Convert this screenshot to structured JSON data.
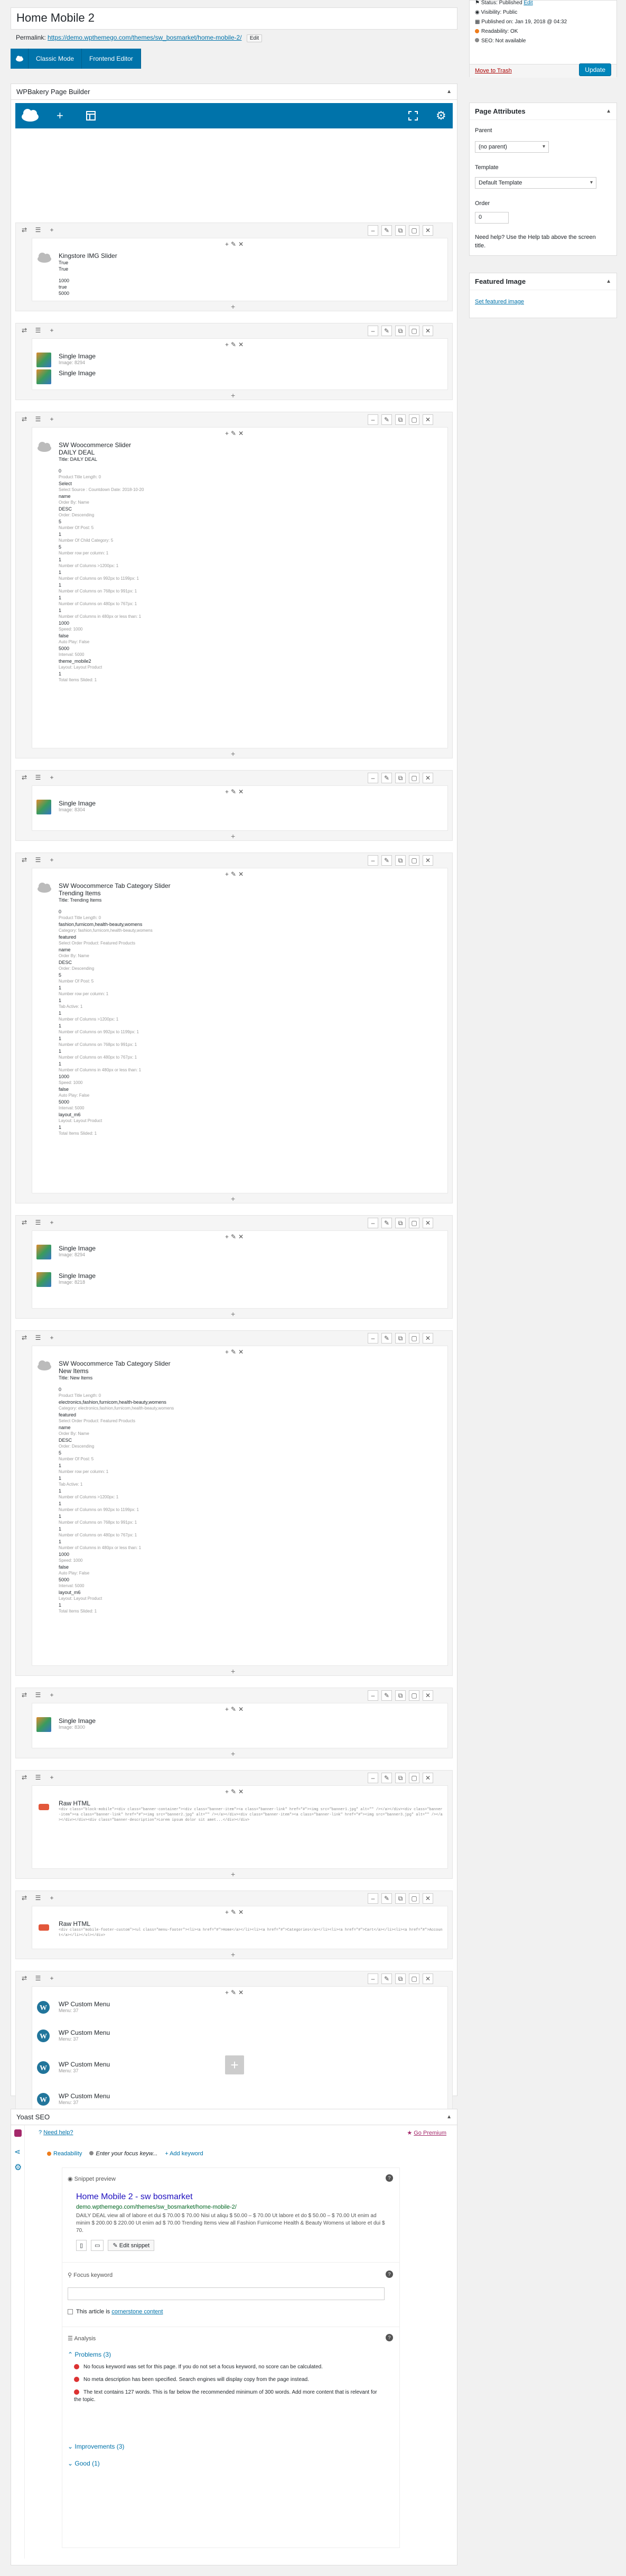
{
  "post": {
    "title": "Home Mobile 2",
    "permalink_label": "Permalink:",
    "permalink_url": "https://demo.wpthemego.com/themes/sw_bosmarket/home-mobile-2/",
    "permalink_edit": "Edit"
  },
  "modes": {
    "classic": "Classic Mode",
    "frontend": "Frontend Editor"
  },
  "builder": {
    "title": "WPBakery Page Builder"
  },
  "rows": [
    {
      "elements": [
        {
          "title": "Kingstore IMG Slider",
          "lines": [
            "True",
            "True",
            "",
            "1000",
            "true",
            "5000"
          ]
        }
      ]
    },
    {
      "elements": [
        {
          "title": "Single Image",
          "sub": "Image: 8294"
        },
        {
          "title": "Single Image",
          "sub": ""
        }
      ]
    },
    {
      "elements": [
        {
          "title": "SW Woocommerce Slider",
          "sub": "DAILY DEAL",
          "lines": [
            "Title: DAILY DEAL",
            "",
            "0",
            "Product Title Length: 0",
            "Select",
            "Select Source : Countdown Date: 2018-10-20",
            "name",
            "Order By: Name",
            "DESC",
            "Order: Descending",
            "5",
            "Number Of Post: 5",
            "1",
            "Number Of Child Category: 5",
            "5",
            "Number row per column: 1",
            "1",
            "Number of Columns >1200px: 1",
            "1",
            "Number of Columns on 992px to 1199px: 1",
            "1",
            "Number of Columns on 768px to 991px: 1",
            "1",
            "Number of Columns on 480px to 767px: 1",
            "1",
            "Number of Columns in 480px or less than: 1",
            "1000",
            "Speed: 1000",
            "false",
            "Auto Play: False",
            "5000",
            "Interval: 5000",
            "theme_mobile2",
            "Layout: Layout Product",
            "1",
            "Total Items Slided: 1"
          ]
        }
      ]
    },
    {
      "elements": [
        {
          "title": "Single Image",
          "sub": "Image: 8304"
        }
      ]
    },
    {
      "elements": [
        {
          "title": "SW Woocommerce Tab Category Slider",
          "sub": "Trending Items",
          "lines": [
            "Title: Trending Items",
            "",
            "0",
            "Product Title Length: 0",
            "fashion,furnicom,health-beauty,womens",
            "Category: fashion,furnicom,health-beauty,womens",
            "featured",
            "Select Order Product: Featured Products",
            "name",
            "Order By: Name",
            "DESC",
            "Order: Descending",
            "5",
            "Number Of Post: 5",
            "1",
            "Number row per column: 1",
            "1",
            "Tab Active: 1",
            "1",
            "Number of Columns >1200px: 1",
            "1",
            "Number of Columns on 992px to 1199px: 1",
            "1",
            "Number of Columns on 768px to 991px: 1",
            "1",
            "Number of Columns on 480px to 767px: 1",
            "1",
            "Number of Columns in 480px or less than: 1",
            "1000",
            "Speed: 1000",
            "false",
            "Auto Play: False",
            "5000",
            "Interval: 5000",
            "layout_m6",
            "Layout: Layout Product",
            "1",
            "Total Items Slided: 1"
          ]
        }
      ]
    },
    {
      "elements": [
        {
          "title": "Single Image",
          "sub": "Image: 8294"
        },
        {
          "title": "Single Image",
          "sub": "Image: 8218"
        }
      ]
    },
    {
      "elements": [
        {
          "title": "SW Woocommerce Tab Category Slider",
          "sub": "New Items",
          "lines": [
            "Title: New Items",
            "",
            "0",
            "Product Title Length: 0",
            "electronics,fashion,furnicom,health-beauty,womens",
            "Category: electronics,fashion,furnicom,health-beauty,womens",
            "featured",
            "Select Order Product: Featured Products",
            "name",
            "Order By: Name",
            "DESC",
            "Order: Descending",
            "5",
            "Number Of Post: 5",
            "1",
            "Number row per column: 1",
            "1",
            "Tab Active: 1",
            "1",
            "Number of Columns >1200px: 1",
            "1",
            "Number of Columns on 992px to 1199px: 1",
            "1",
            "Number of Columns on 768px to 991px: 1",
            "1",
            "Number of Columns on 480px to 767px: 1",
            "1",
            "Number of Columns in 480px or less than: 1",
            "1000",
            "Speed: 1000",
            "false",
            "Auto Play: False",
            "5000",
            "Interval: 5000",
            "layout_m6",
            "Layout: Layout Product",
            "1",
            "Total Items Slided: 1"
          ]
        }
      ]
    },
    {
      "elements": [
        {
          "title": "Single Image",
          "sub": "Image: 8300"
        }
      ]
    },
    {
      "elements": [
        {
          "title": "Raw HTML",
          "code": "<div class=\"block-mobile\"><div class=\"banner-container\"><div class=\"banner-item\"><a class=\"banner-link\" href=\"#\"><img src=\"banner1.jpg\" alt=\"\" /></a></div><div class=\"banner-item\"><a class=\"banner-link\" href=\"#\"><img src=\"banner2.jpg\" alt=\"\" /></a></div><div class=\"banner-item\"><a class=\"banner-link\" href=\"#\"><img src=\"banner3.jpg\" alt=\"\" /></a></div></div><div class=\"banner-description\">Lorem ipsum dolor sit amet...</div></div>"
        }
      ]
    },
    {
      "elements": [
        {
          "title": "Raw HTML",
          "code": "<div class=\"mobile-footer-custom\"><ul class=\"menu-footer\"><li><a href=\"#\">Home</a></li><li><a href=\"#\">Categories</a></li><li><a href=\"#\">Cart</a></li><li><a href=\"#\">Account</a></li></ul></div>"
        }
      ]
    },
    {
      "elements": [
        {
          "title": "WP Custom Menu",
          "sub": "Menu: 37"
        },
        {
          "title": "WP Custom Menu",
          "sub": "Menu: 37"
        },
        {
          "title": "WP Custom Menu",
          "sub": "Menu: 37"
        },
        {
          "title": "WP Custom Menu",
          "sub": "Menu: 37"
        }
      ]
    }
  ],
  "sidebar": {
    "publish": {
      "status_label": "Status: Published",
      "status_edit": "Edit",
      "visibility": "Visibility: Public",
      "published_on": "Published on: Jan 19, 2018 @ 04:32",
      "readability": "Readability: OK",
      "seo": "SEO: Not available",
      "trash": "Move to Trash",
      "update": "Update"
    },
    "attributes": {
      "title": "Page Attributes",
      "parent_label": "Parent",
      "parent_value": "(no parent)",
      "template_label": "Template",
      "template_value": "Default Template",
      "order_label": "Order",
      "order_value": "0",
      "help": "Need help? Use the Help tab above the screen title."
    },
    "featured": {
      "title": "Featured Image",
      "link": "Set featured image"
    }
  },
  "yoast": {
    "title": "Yoast SEO",
    "need_help": "Need help?",
    "go_premium": "Go Premium",
    "tab_readability": "Readability",
    "tab_focus": "Enter your focus keyw...",
    "tab_add": "+ Add keyword",
    "snippet_label": "Snippet preview",
    "snippet_title": "Home Mobile 2 - sw bosmarket",
    "snippet_url": "demo.wpthemego.com/themes/sw_bosmarket/home-mobile-2/",
    "snippet_desc": "DAILY DEAL view all of labore et dui $ 70.00 $ 70.00 Nisi ut aliqu $ 50.00 – $ 70.00 Ut labore et do $ 50.00 – $ 70.00 Ut enim ad minim $ 200.00 $ 220.00 Ut enim ad $ 70.00 Trending Items view all Fashion Furnicome Health & Beauty Womens ut labore et dui $ 70.",
    "edit_snippet": "Edit snippet",
    "focus_label": "Focus keyword",
    "cornerstone_text": "This article is",
    "cornerstone_link": "cornerstone content",
    "analysis_label": "Analysis",
    "problems": "Problems (3)",
    "problem_items": [
      "No focus keyword was set for this page. If you do not set a focus keyword, no score can be calculated.",
      "No meta description has been specified. Search engines will display copy from the page instead.",
      "The text contains 127 words. This is far below the recommended minimum of 300 words. Add more content that is relevant for the topic."
    ],
    "improvements": "Improvements (3)",
    "good": "Good (1)"
  }
}
